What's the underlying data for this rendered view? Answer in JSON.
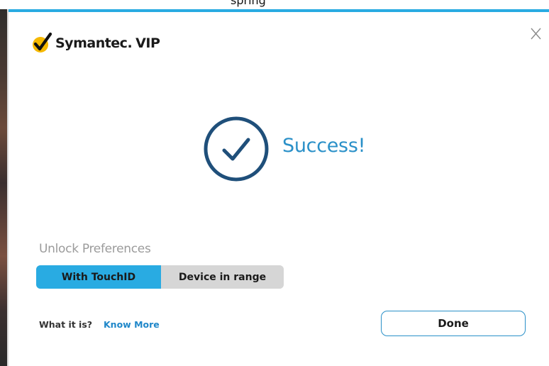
{
  "window": {
    "top_text": "spring"
  },
  "header": {
    "brand_name": "Symantec.",
    "brand_product": "VIP",
    "close_label": "X"
  },
  "status": {
    "message": "Success!",
    "icon": "checkmark-circle-icon"
  },
  "unlock_preferences": {
    "label": "Unlock Preferences",
    "options": [
      {
        "label": "With TouchID",
        "selected": true
      },
      {
        "label": "Device in range",
        "selected": false
      }
    ]
  },
  "footer": {
    "what_label": "What it is?",
    "know_more_label": "Know More",
    "done_label": "Done"
  },
  "colors": {
    "accent": "#29abe2",
    "circle": "#1f4f7a",
    "success_text": "#2a90c8",
    "logo_yellow": "#f5b800"
  }
}
